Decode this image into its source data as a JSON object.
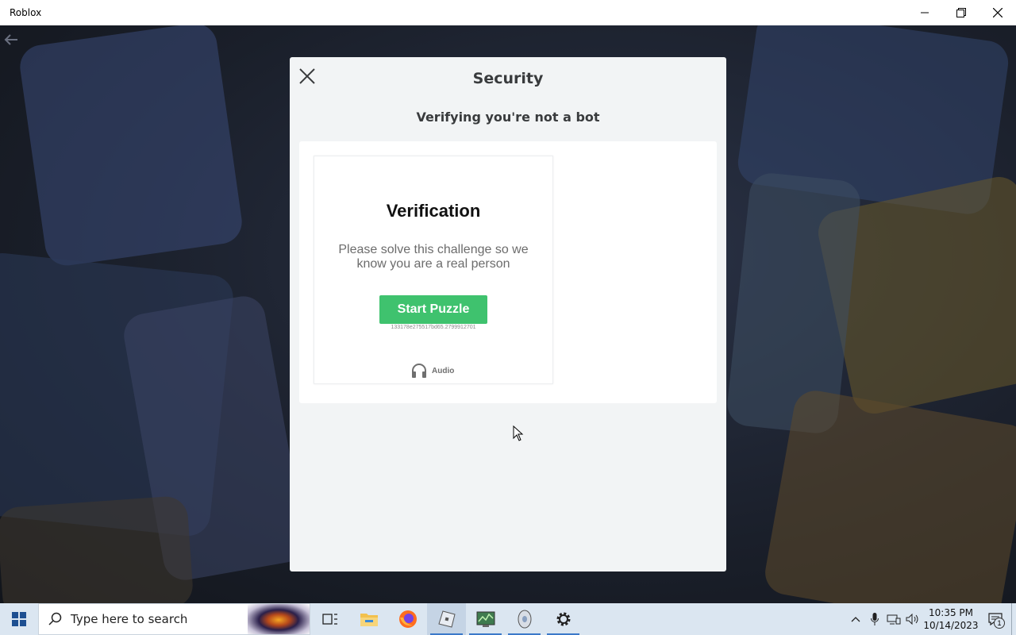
{
  "window": {
    "title": "Roblox",
    "controls": [
      "minimize-icon",
      "restore-icon",
      "close-icon"
    ]
  },
  "modal": {
    "title": "Security",
    "subtitle": "Verifying you're not a bot",
    "close_icon": "close-icon"
  },
  "challenge": {
    "title": "Verification",
    "description": "Please solve this challenge so we know you are a real person",
    "button_label": "Start Puzzle",
    "session_id": "133178e275517bd65.2799912701",
    "audio_label": "Audio",
    "audio_icon": "headphones-icon",
    "button_color": "#3fc26e"
  },
  "taskbar": {
    "search_placeholder": "Type here to search",
    "apps": [
      "task-view-icon",
      "file-explorer-icon",
      "firefox-icon",
      "roblox-icon",
      "task-manager-icon",
      "disk-icon",
      "settings-icon"
    ],
    "tray": {
      "time": "10:35 PM",
      "date": "10/14/2023",
      "notification_count": "1"
    }
  }
}
